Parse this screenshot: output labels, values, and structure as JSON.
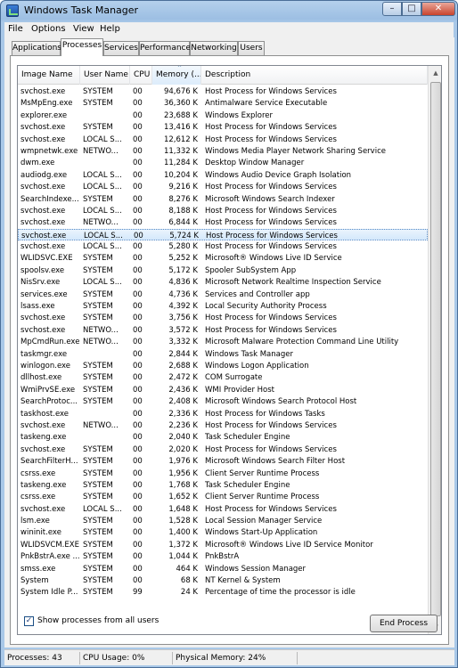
{
  "window": {
    "title": "Windows Task Manager",
    "min_glyph": "–",
    "max_glyph": "□",
    "close_glyph": "✕"
  },
  "menu": {
    "items": [
      "File",
      "Options",
      "View",
      "Help"
    ]
  },
  "tabs": [
    "Applications",
    "Processes",
    "Services",
    "Performance",
    "Networking",
    "Users"
  ],
  "active_tab": "Processes",
  "columns": [
    "Image Name",
    "User Name",
    "CPU",
    "Memory (...",
    "Description"
  ],
  "rows": [
    [
      "svchost.exe",
      "SYSTEM",
      "00",
      "94,676 K",
      "Host Process for Windows Services"
    ],
    [
      "MsMpEng.exe",
      "SYSTEM",
      "00",
      "36,360 K",
      "Antimalware Service Executable"
    ],
    [
      "explorer.exe",
      "",
      "00",
      "23,688 K",
      "Windows Explorer"
    ],
    [
      "svchost.exe",
      "SYSTEM",
      "00",
      "13,416 K",
      "Host Process for Windows Services"
    ],
    [
      "svchost.exe",
      "LOCAL S...",
      "00",
      "12,612 K",
      "Host Process for Windows Services"
    ],
    [
      "wmpnetwk.exe",
      "NETWO...",
      "00",
      "11,332 K",
      "Windows Media Player Network Sharing Service"
    ],
    [
      "dwm.exe",
      "",
      "00",
      "11,284 K",
      "Desktop Window Manager"
    ],
    [
      "audiodg.exe",
      "LOCAL S...",
      "00",
      "10,204 K",
      "Windows Audio Device Graph Isolation"
    ],
    [
      "svchost.exe",
      "LOCAL S...",
      "00",
      "9,216 K",
      "Host Process for Windows Services"
    ],
    [
      "SearchIndexe...",
      "SYSTEM",
      "00",
      "8,276 K",
      "Microsoft Windows Search Indexer"
    ],
    [
      "svchost.exe",
      "LOCAL S...",
      "00",
      "8,188 K",
      "Host Process for Windows Services"
    ],
    [
      "svchost.exe",
      "NETWO...",
      "00",
      "6,844 K",
      "Host Process for Windows Services"
    ],
    [
      "svchost.exe",
      "LOCAL S...",
      "00",
      "5,724 K",
      "Host Process for Windows Services"
    ],
    [
      "svchost.exe",
      "LOCAL S...",
      "00",
      "5,280 K",
      "Host Process for Windows Services"
    ],
    [
      "WLIDSVC.EXE",
      "SYSTEM",
      "00",
      "5,252 K",
      "Microsoft® Windows Live ID Service"
    ],
    [
      "spoolsv.exe",
      "SYSTEM",
      "00",
      "5,172 K",
      "Spooler SubSystem App"
    ],
    [
      "NisSrv.exe",
      "LOCAL S...",
      "00",
      "4,836 K",
      "Microsoft Network Realtime Inspection Service"
    ],
    [
      "services.exe",
      "SYSTEM",
      "00",
      "4,736 K",
      "Services and Controller app"
    ],
    [
      "lsass.exe",
      "SYSTEM",
      "00",
      "4,392 K",
      "Local Security Authority Process"
    ],
    [
      "svchost.exe",
      "SYSTEM",
      "00",
      "3,756 K",
      "Host Process for Windows Services"
    ],
    [
      "svchost.exe",
      "NETWO...",
      "00",
      "3,572 K",
      "Host Process for Windows Services"
    ],
    [
      "MpCmdRun.exe",
      "NETWO...",
      "00",
      "3,332 K",
      "Microsoft Malware Protection Command Line Utility"
    ],
    [
      "taskmgr.exe",
      "",
      "00",
      "2,844 K",
      "Windows Task Manager"
    ],
    [
      "winlogon.exe",
      "SYSTEM",
      "00",
      "2,688 K",
      "Windows Logon Application"
    ],
    [
      "dllhost.exe",
      "SYSTEM",
      "00",
      "2,472 K",
      "COM Surrogate"
    ],
    [
      "WmiPrvSE.exe",
      "SYSTEM",
      "00",
      "2,436 K",
      "WMI Provider Host"
    ],
    [
      "SearchProtoc...",
      "SYSTEM",
      "00",
      "2,408 K",
      "Microsoft Windows Search Protocol Host"
    ],
    [
      "taskhost.exe",
      "",
      "00",
      "2,336 K",
      "Host Process for Windows Tasks"
    ],
    [
      "svchost.exe",
      "NETWO...",
      "00",
      "2,236 K",
      "Host Process for Windows Services"
    ],
    [
      "taskeng.exe",
      "",
      "00",
      "2,040 K",
      "Task Scheduler Engine"
    ],
    [
      "svchost.exe",
      "SYSTEM",
      "00",
      "2,020 K",
      "Host Process for Windows Services"
    ],
    [
      "SearchFilterH...",
      "SYSTEM",
      "00",
      "1,976 K",
      "Microsoft Windows Search Filter Host"
    ],
    [
      "csrss.exe",
      "SYSTEM",
      "00",
      "1,956 K",
      "Client Server Runtime Process"
    ],
    [
      "taskeng.exe",
      "SYSTEM",
      "00",
      "1,768 K",
      "Task Scheduler Engine"
    ],
    [
      "csrss.exe",
      "SYSTEM",
      "00",
      "1,652 K",
      "Client Server Runtime Process"
    ],
    [
      "svchost.exe",
      "LOCAL S...",
      "00",
      "1,648 K",
      "Host Process for Windows Services"
    ],
    [
      "lsm.exe",
      "SYSTEM",
      "00",
      "1,528 K",
      "Local Session Manager Service"
    ],
    [
      "wininit.exe",
      "SYSTEM",
      "00",
      "1,400 K",
      "Windows Start-Up Application"
    ],
    [
      "WLIDSVCM.EXE",
      "SYSTEM",
      "00",
      "1,372 K",
      "Microsoft® Windows Live ID Service Monitor"
    ],
    [
      "PnkBstrA.exe ...",
      "SYSTEM",
      "00",
      "1,044 K",
      "PnkBstrA"
    ],
    [
      "smss.exe",
      "SYSTEM",
      "00",
      "464 K",
      "Windows Session Manager"
    ],
    [
      "System",
      "SYSTEM",
      "00",
      "68 K",
      "NT Kernel & System"
    ],
    [
      "System Idle P...",
      "SYSTEM",
      "99",
      "24 K",
      "Percentage of time the processor is idle"
    ]
  ],
  "selected_row": 12,
  "show_all_checkbox": {
    "label": "Show processes from all users",
    "checked": true,
    "glyph": "✓"
  },
  "end_process_button": "End Process",
  "status": {
    "processes": "Processes: 43",
    "cpu": "CPU Usage: 0%",
    "memory": "Physical Memory: 24%"
  },
  "scroll_glyphs": {
    "up": "▲",
    "down": "▼",
    "sort": "^"
  }
}
